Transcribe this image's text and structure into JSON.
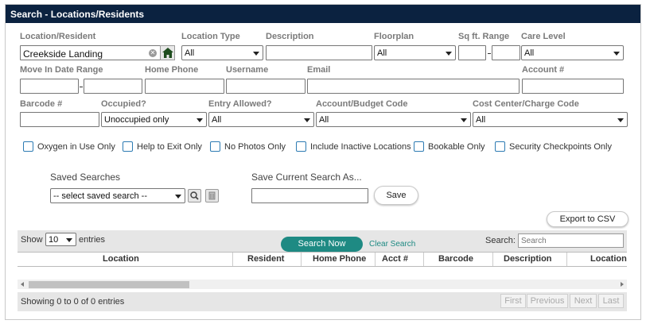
{
  "title": "Search - Locations/Residents",
  "labels": {
    "location_resident": "Location/Resident",
    "location_type": "Location Type",
    "description": "Description",
    "floorplan": "Floorplan",
    "sqft_range": "Sq ft. Range",
    "care_level": "Care Level",
    "move_in_date_range": "Move In Date Range",
    "home_phone": "Home Phone",
    "username": "Username",
    "email": "Email",
    "account_num": "Account #",
    "barcode_num": "Barcode #",
    "occupied": "Occupied?",
    "entry_allowed": "Entry Allowed?",
    "account_budget_code": "Account/Budget Code",
    "cost_center_charge_code": "Cost Center/Charge Code"
  },
  "fields": {
    "location_resident_value": "Creekside Landing",
    "location_type_value": "All",
    "floorplan_value": "All",
    "care_level_value": "All",
    "occupied_value": "Unoccupied only",
    "entry_allowed_value": "All",
    "account_budget_code_value": "All",
    "cost_center_charge_code_value": "All"
  },
  "checkboxes": [
    {
      "label": "Oxygen in Use Only",
      "checked": false
    },
    {
      "label": "Help to Exit Only",
      "checked": false
    },
    {
      "label": "No Photos Only",
      "checked": false
    },
    {
      "label": "Include Inactive Locations",
      "checked": false
    },
    {
      "label": "Bookable Only",
      "checked": false
    },
    {
      "label": "Security Checkpoints Only",
      "checked": false
    }
  ],
  "saved_searches": {
    "label": "Saved Searches",
    "select_value": "-- select saved search --"
  },
  "save_current": {
    "label": "Save Current Search As...",
    "save_button": "Save"
  },
  "export_button": "Export to CSV",
  "grid": {
    "show_label": "Show",
    "page_size": "10",
    "entries_label": "entries",
    "search_now": "Search Now",
    "clear_search": "Clear Search",
    "search_label": "Search:",
    "search_placeholder": "Search",
    "columns": [
      "Location",
      "Resident",
      "Home Phone",
      "Acct #",
      "Barcode",
      "Description",
      "Location"
    ],
    "info": "Showing 0 to 0 of 0 entries",
    "pager": [
      "First",
      "Previous",
      "Next",
      "Last"
    ]
  },
  "colors": {
    "title_bar": "#0b2240",
    "accent": "#1e8a83",
    "checkbox_border": "#2d7bb3"
  },
  "icons": [
    "clear-icon",
    "home-icon",
    "search-icon",
    "delete-icon",
    "chevron-down-icon"
  ]
}
